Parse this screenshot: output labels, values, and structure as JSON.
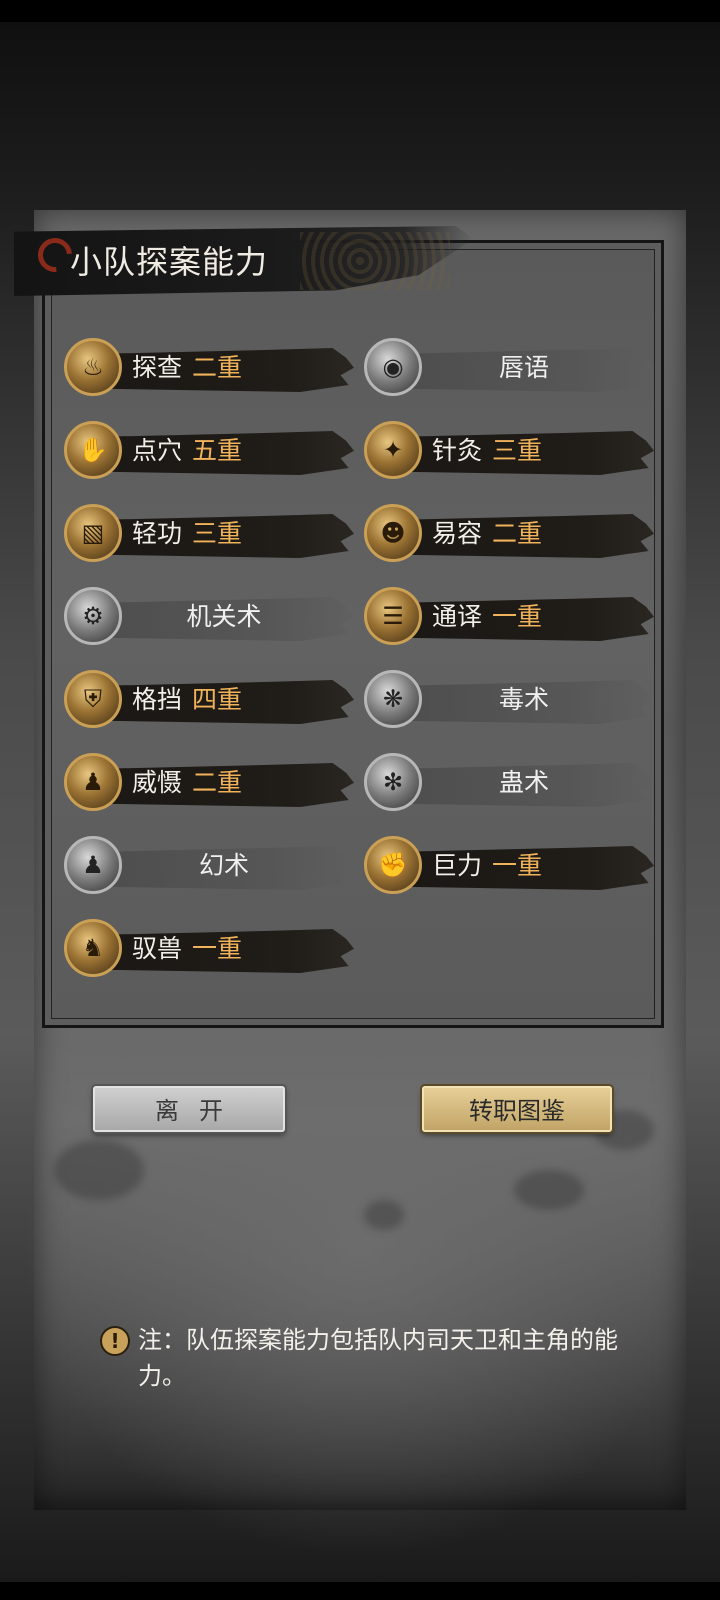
{
  "panel": {
    "title": "小队探案能力"
  },
  "skills": [
    {
      "name": "探查",
      "level": "二重",
      "active": true,
      "icon": "candle-icon"
    },
    {
      "name": "唇语",
      "level": "",
      "active": false,
      "icon": "lips-icon"
    },
    {
      "name": "点穴",
      "level": "五重",
      "active": true,
      "icon": "pressure-point-icon"
    },
    {
      "name": "针灸",
      "level": "三重",
      "active": true,
      "icon": "needle-icon"
    },
    {
      "name": "轻功",
      "level": "三重",
      "active": true,
      "icon": "boot-icon"
    },
    {
      "name": "易容",
      "level": "二重",
      "active": true,
      "icon": "mask-icon"
    },
    {
      "name": "机关术",
      "level": "",
      "active": false,
      "icon": "gear-icon"
    },
    {
      "name": "通译",
      "level": "一重",
      "active": true,
      "icon": "scroll-icon"
    },
    {
      "name": "格挡",
      "level": "四重",
      "active": true,
      "icon": "shield-icon"
    },
    {
      "name": "毒术",
      "level": "",
      "active": false,
      "icon": "spider-icon"
    },
    {
      "name": "威慑",
      "level": "二重",
      "active": true,
      "icon": "warrior-icon"
    },
    {
      "name": "蛊术",
      "level": "",
      "active": false,
      "icon": "gu-worm-icon"
    },
    {
      "name": "幻术",
      "level": "",
      "active": false,
      "icon": "hooded-figure-icon"
    },
    {
      "name": "巨力",
      "level": "一重",
      "active": true,
      "icon": "fist-icon"
    },
    {
      "name": "驭兽",
      "level": "一重",
      "active": true,
      "icon": "wolf-icon"
    }
  ],
  "buttons": {
    "leave": "离开",
    "gallery": "转职图鉴"
  },
  "note": {
    "text": "注：队伍探案能力包括队内司天卫和主角的能力。"
  },
  "colors": {
    "level_text": "#f0b25a",
    "gold_button": "#d8bc7e"
  }
}
